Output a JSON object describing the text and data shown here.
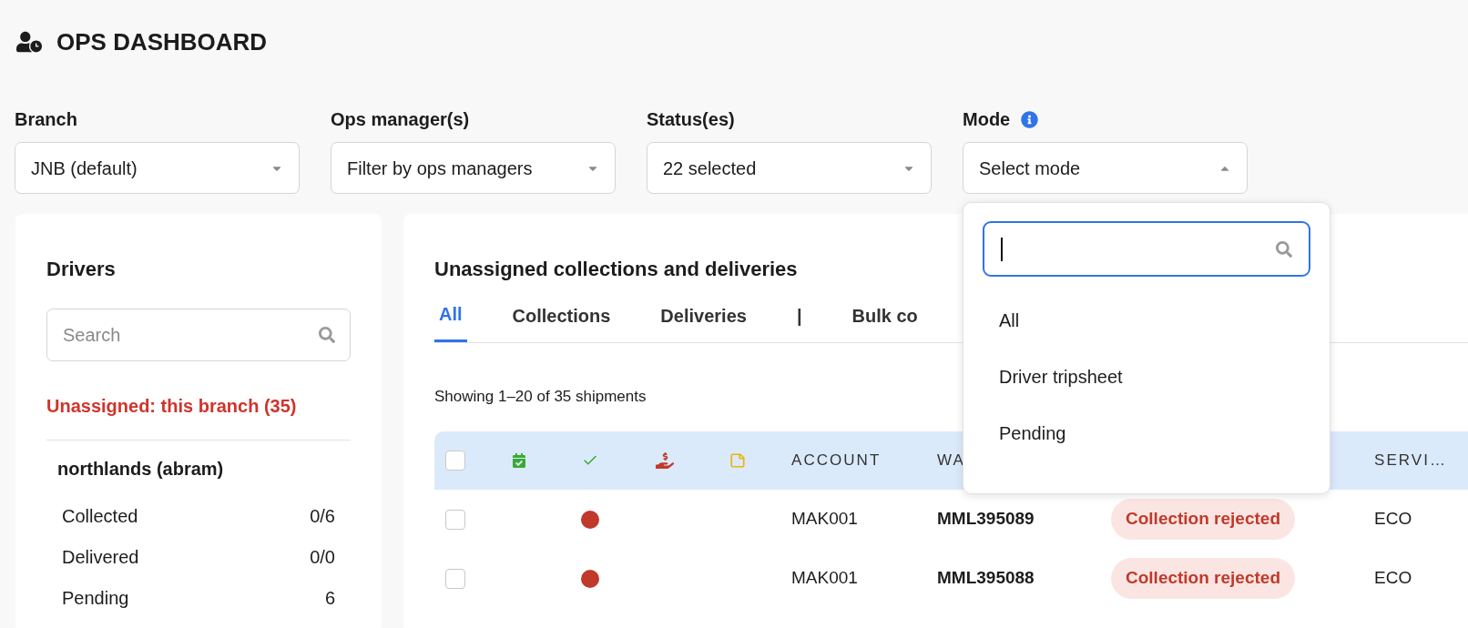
{
  "header": {
    "title": "OPS DASHBOARD"
  },
  "filters": [
    {
      "kind": "plain",
      "label": "Branch",
      "value": "JNB (default)",
      "expanded": false
    },
    {
      "kind": "plain",
      "label": "Ops manager(s)",
      "value": "Filter by ops managers",
      "expanded": false
    },
    {
      "kind": "plain",
      "label": "Status(es)",
      "value": "22 selected",
      "expanded": false
    },
    {
      "kind": "with_info",
      "label": "Mode",
      "value": "Select mode",
      "expanded": true
    }
  ],
  "mode_dropdown": {
    "options": [
      "All",
      "Driver tripsheet",
      "Pending"
    ]
  },
  "drivers": {
    "title": "Drivers",
    "search": {
      "placeholder": "Search"
    },
    "unassigned": "Unassigned: this branch (35)",
    "groups": [
      {
        "name": "northlands (abram)",
        "stats": [
          {
            "label": "Collected",
            "value": "0/6"
          },
          {
            "label": "Delivered",
            "value": "0/0"
          },
          {
            "label": "Pending",
            "value": "6"
          }
        ]
      }
    ]
  },
  "main": {
    "title": "Unassigned collections and deliveries",
    "tabs": [
      {
        "label": "All",
        "selected": true
      },
      {
        "label": "Collections",
        "selected": false
      },
      {
        "label": "Deliveries",
        "selected": false
      },
      {
        "label": "|",
        "selected": false
      },
      {
        "label": "Bulk co",
        "selected": false
      }
    ],
    "showing": "Showing 1–20 of 35 shipments",
    "table": {
      "header_checked": false,
      "columns": [
        {
          "kind": "checkbox"
        },
        {
          "kind": "calendar"
        },
        {
          "kind": "check"
        },
        {
          "kind": "payment"
        },
        {
          "kind": "note"
        },
        {
          "kind": "text",
          "label": "ACCOUNT"
        },
        {
          "kind": "text",
          "label": "WA"
        },
        {
          "kind": "blank"
        },
        {
          "kind": "text",
          "label": "SERVI…"
        }
      ],
      "rows": [
        {
          "checked": false,
          "color": "#c0392b",
          "account": "MAK001",
          "waybill": "MML395089",
          "status": "Collection rejected",
          "service": "ECO"
        },
        {
          "checked": false,
          "color": "#c0392b",
          "account": "MAK001",
          "waybill": "MML395088",
          "status": "Collection rejected",
          "service": "ECO"
        }
      ]
    }
  }
}
